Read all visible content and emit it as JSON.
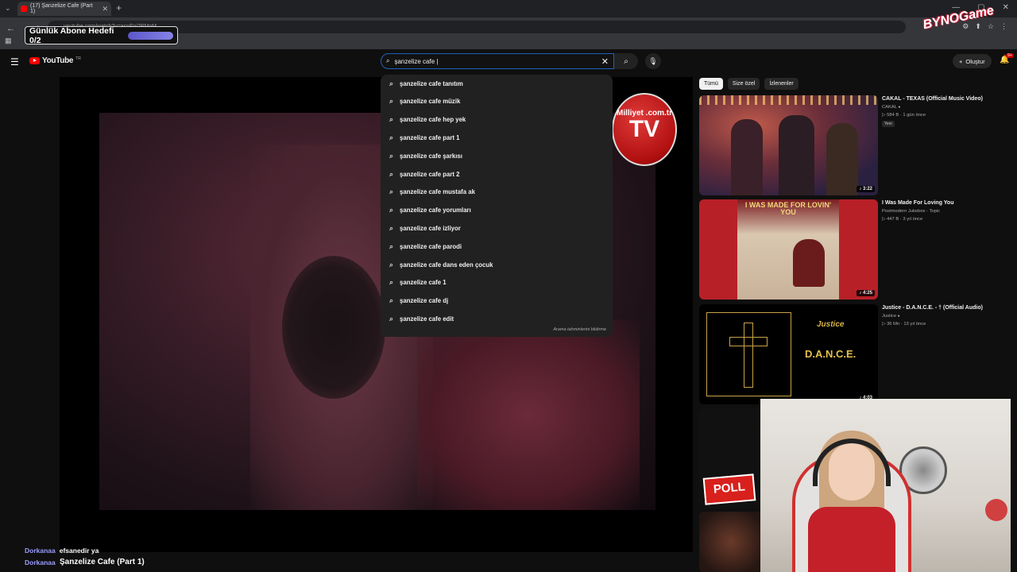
{
  "browser": {
    "tab_title": "(17) Şanzelize Cafe (Part 1)",
    "tab_close": "✕",
    "new_tab": "+",
    "tab_menu": "⌄",
    "url": "youtube.com/watch?v=acnFni2BMoM",
    "back": "←",
    "reload": "⟳",
    "apps": "▦",
    "ext_icons": [
      "⚙",
      "⬆",
      "☆",
      "⋮"
    ],
    "win_controls": [
      "—",
      "▢",
      "✕"
    ]
  },
  "overlay": {
    "goal_label": "Günlük Abone Hedefi 0/2",
    "watermark": "BYNOGame"
  },
  "youtube": {
    "menu_icon": "☰",
    "logo_word": "YouTube",
    "logo_region": "TR",
    "search_value": "şanzelize cafe |",
    "search_icon": "⌕",
    "clear_icon": "✕",
    "mic_icon": "🎙",
    "create_label": "Oluştur",
    "create_icon": "+",
    "bell_icon": "🔔",
    "notif_count": "9+"
  },
  "suggestions": {
    "items": [
      "şanzelize cafe tanıtım",
      "şanzelize cafe müzik",
      "şanzelize cafe hep yek",
      "şanzelize cafe part 1",
      "şanzelize cafe şarkısı",
      "şanzelize cafe part 2",
      "şanzelize cafe mustafa ak",
      "şanzelize cafe yorumları",
      "şanzelize cafe izliyor",
      "şanzelize cafe parodi",
      "şanzelize cafe dans eden çocuk",
      "şanzelize cafe 1",
      "şanzelize cafe dj",
      "şanzelize cafe edit"
    ],
    "footer": "Arama tahminlerini bildirme"
  },
  "player": {
    "tv_small": "Milliyet .com.tr",
    "tv_big": "TV"
  },
  "chips": [
    "Tümü",
    "Size özel",
    "İzlenenler"
  ],
  "recommendations": [
    {
      "title": "CAKAL - TEXAS (Official Music Video)",
      "channel": "CAKAL",
      "verified": "●",
      "stats": "▷ 584 B · 1 gün önce",
      "badge": "Yeni",
      "duration": "♪ 3:22"
    },
    {
      "title": "I Was Made For Loving You",
      "channel": "Postmodern Jukebox - Topic",
      "verified": "",
      "stats": "▷ 447 B · 3 yıl önce",
      "badge": "",
      "duration": "♪ 4:25"
    },
    {
      "title": "Justice - D.A.N.C.E. - † (Official Audio)",
      "channel": "Justice",
      "verified": "●",
      "stats": "▷ 36 Mn · 13 yıl önce",
      "badge": "",
      "duration": "♪ 4:03"
    }
  ],
  "thumb_text": {
    "loving_you": "I WAS MADE FOR LOVIN' YOU",
    "justice_brand": "Justice",
    "dance": "D.A.N.C.E.",
    "poll": "POLL"
  },
  "chat": [
    {
      "user": "Dorkanaa",
      "msg": "efsanedir ya"
    },
    {
      "user": "Dorkanaa",
      "msg": ""
    }
  ],
  "now_playing": "Şanzelize Cafe (Part 1)",
  "colors": {
    "accent_red": "#ff0000",
    "chat_user": "#9b9dff",
    "search_border": "#1c62b9"
  }
}
